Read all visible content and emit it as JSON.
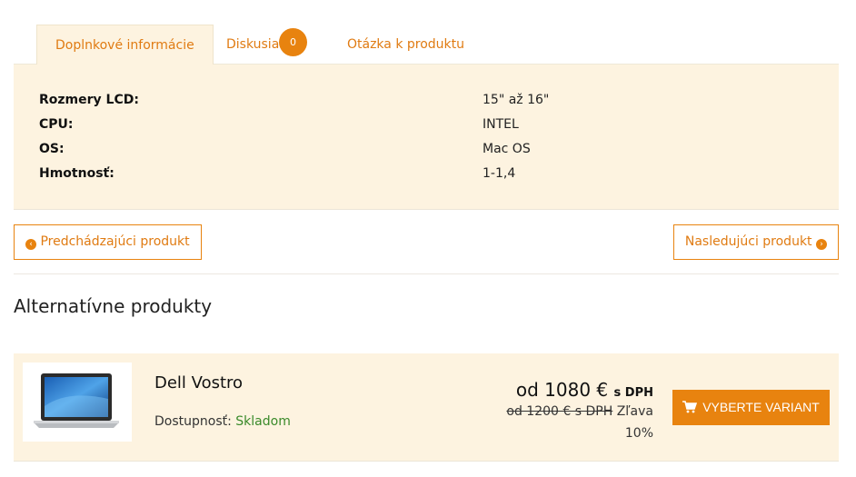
{
  "tabs": {
    "additional_info": "Doplnkové informácie",
    "discussion": "Diskusia",
    "discussion_count": "0",
    "question": "Otázka k produktu"
  },
  "specs": [
    {
      "key": "Rozmery LCD:",
      "value": "15\" až 16\""
    },
    {
      "key": "CPU:",
      "value": "INTEL"
    },
    {
      "key": "OS:",
      "value": "Mac OS"
    },
    {
      "key": "Hmotnosť:",
      "value": "1-1,4"
    }
  ],
  "navigation": {
    "prev_label": "Predchádzajúci produkt",
    "next_label": "Nasledujúci produkt"
  },
  "alternatives": {
    "heading": "Alternatívne produkty",
    "product": {
      "name": "Dell Vostro",
      "availability_label": "Dostupnosť:",
      "availability_status": "Skladom",
      "price": "od 1080 €",
      "price_suffix": "s DPH",
      "old_price": "od 1200 € s DPH",
      "discount_label": "Zľava",
      "discount_value": "10%",
      "button_label": "VYBERTE VARIANT"
    }
  },
  "colors": {
    "accent": "#e8830f",
    "panel": "#fdf3e0",
    "in_stock": "#3a8a2a"
  }
}
